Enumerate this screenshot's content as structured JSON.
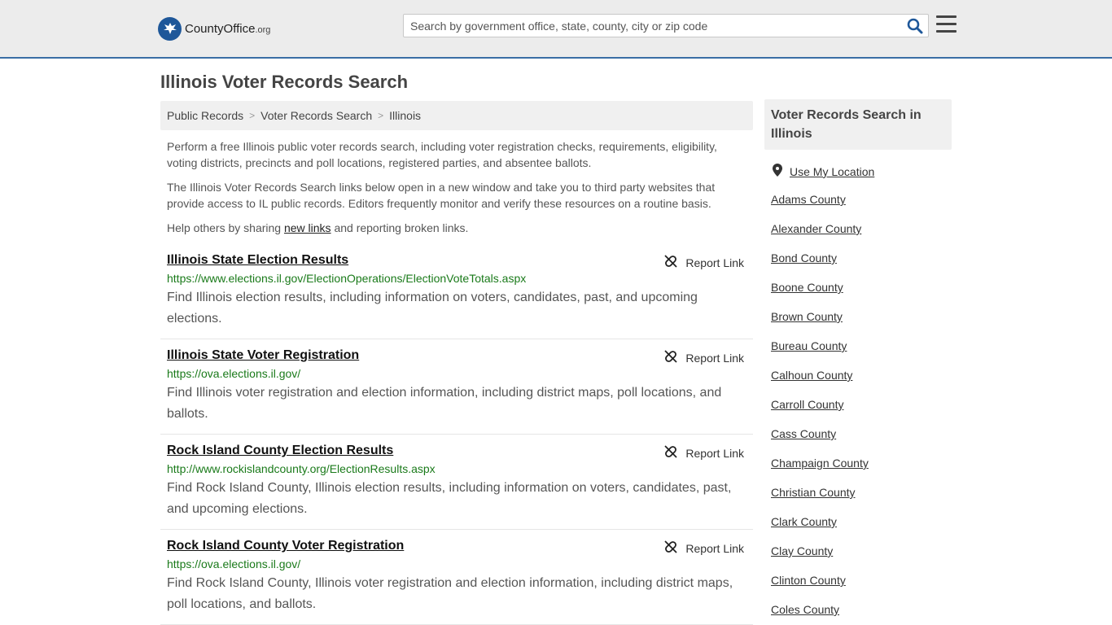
{
  "header": {
    "logo_text_county": "County",
    "logo_text_office": "Office",
    "logo_text_org": ".org",
    "search_placeholder": "Search by government office, state, county, city or zip code"
  },
  "page": {
    "title": "Illinois Voter Records Search"
  },
  "breadcrumb": [
    "Public Records",
    "Voter Records Search",
    "Illinois"
  ],
  "intro": {
    "p1": "Perform a free Illinois public voter records search, including voter registration checks, requirements, eligibility, voting districts, precincts and poll locations, registered parties, and absentee ballots.",
    "p2": "The Illinois Voter Records Search links below open in a new window and take you to third party websites that provide access to IL public records. Editors frequently monitor and verify these resources on a routine basis.",
    "p3_before": "Help others by sharing ",
    "p3_link": "new links",
    "p3_after": " and reporting broken links."
  },
  "results": [
    {
      "title": "Illinois State Election Results",
      "url": "https://www.elections.il.gov/ElectionOperations/ElectionVoteTotals.aspx",
      "desc": "Find Illinois election results, including information on voters, candidates, past, and upcoming elections.",
      "report": "Report Link"
    },
    {
      "title": "Illinois State Voter Registration",
      "url": "https://ova.elections.il.gov/",
      "desc": "Find Illinois voter registration and election information, including district maps, poll locations, and ballots.",
      "report": "Report Link"
    },
    {
      "title": "Rock Island County Election Results",
      "url": "http://www.rockislandcounty.org/ElectionResults.aspx",
      "desc": "Find Rock Island County, Illinois election results, including information on voters, candidates, past, and upcoming elections.",
      "report": "Report Link"
    },
    {
      "title": "Rock Island County Voter Registration",
      "url": "https://ova.elections.il.gov/",
      "desc": "Find Rock Island County, Illinois voter registration and election information, including district maps, poll locations, and ballots.",
      "report": "Report Link"
    }
  ],
  "sidebar": {
    "heading": "Voter Records Search in Illinois",
    "use_location": "Use My Location",
    "counties": [
      "Adams County",
      "Alexander County",
      "Bond County",
      "Boone County",
      "Brown County",
      "Bureau County",
      "Calhoun County",
      "Carroll County",
      "Cass County",
      "Champaign County",
      "Christian County",
      "Clark County",
      "Clay County",
      "Clinton County",
      "Coles County"
    ]
  },
  "colors": {
    "accent": "#3a6ea5",
    "url_green": "#1a7a1a",
    "logo_blue": "#1e5799",
    "header_bg": "#ececec"
  },
  "icons": {
    "search": "search-icon",
    "menu": "hamburger-menu-icon",
    "report": "broken-link-icon",
    "location": "map-pin-icon"
  }
}
